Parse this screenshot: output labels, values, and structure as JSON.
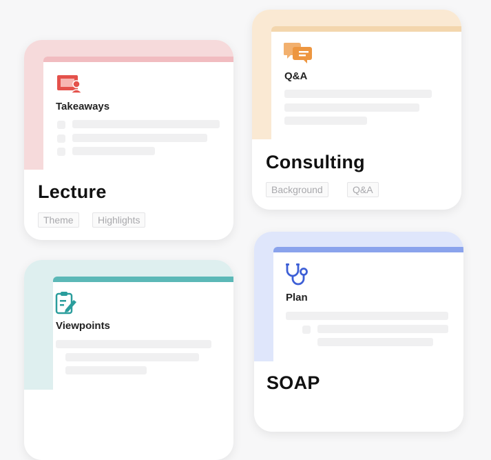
{
  "cards": {
    "lecture": {
      "section_label": "Takeaways",
      "title": "Lecture",
      "tags": [
        "Theme",
        "Highlights"
      ],
      "colors": {
        "top": "#f6dadb",
        "accent": "#f1bcc0",
        "icon": "#e4514b"
      },
      "icon": "presentation-icon"
    },
    "consulting": {
      "section_label": "Q&A",
      "title": "Consulting",
      "tags": [
        "Background",
        "Q&A"
      ],
      "colors": {
        "top": "#fae9d3",
        "accent": "#f3d6ad",
        "icon": "#ed9640"
      },
      "icon": "chat-bubbles-icon"
    },
    "viewpoints": {
      "section_label": "Viewpoints",
      "title": "",
      "tags": [],
      "colors": {
        "top": "#deefef",
        "accent": "#5bb8b7",
        "icon": "#2a9d9c"
      },
      "icon": "clipboard-edit-icon"
    },
    "soap": {
      "section_label": "Plan",
      "title": "SOAP",
      "tags": [],
      "colors": {
        "top": "#dfe6fb",
        "accent": "#8aa3ec",
        "icon": "#3d5fd6"
      },
      "icon": "stethoscope-icon"
    }
  }
}
